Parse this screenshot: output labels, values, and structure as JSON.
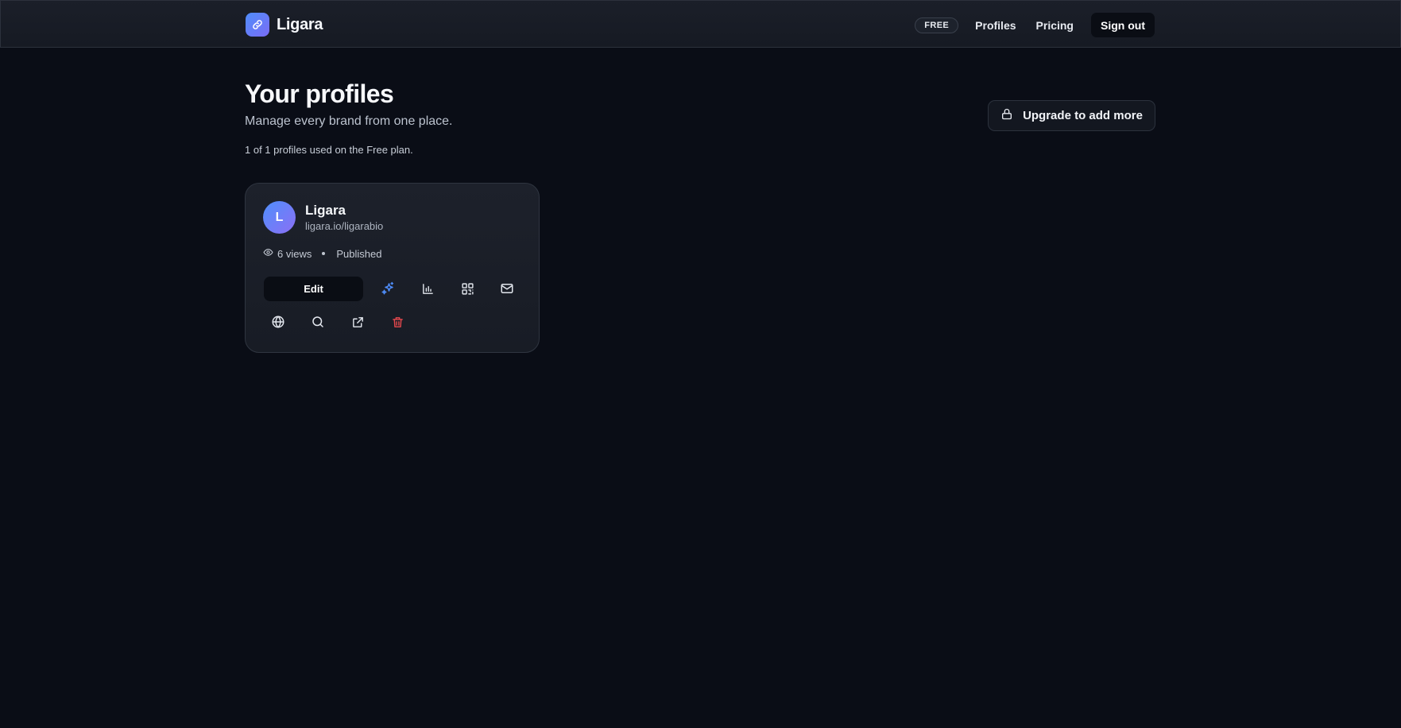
{
  "brand": {
    "name": "Ligara",
    "logo_icon": "link-icon",
    "logo_gradient": [
      "#4f8dfa",
      "#7a6cf6"
    ]
  },
  "nav": {
    "plan_badge": "FREE",
    "profiles": "Profiles",
    "pricing": "Pricing",
    "sign_out": "Sign out"
  },
  "page": {
    "title": "Your profiles",
    "subtitle": "Manage every brand from one place.",
    "usage": "1 of 1 profiles used on the Free plan.",
    "upgrade_label": "Upgrade to add more",
    "upgrade_icon": "lock-icon"
  },
  "profiles": [
    {
      "avatar_initial": "L",
      "name": "Ligara",
      "url": "ligara.io/ligarabio",
      "views": "6 views",
      "status": "Published",
      "edit_label": "Edit",
      "actions_row1": [
        "sparkles-icon",
        "bar-chart-icon",
        "qr-code-icon",
        "mail-icon"
      ],
      "actions_row2": [
        "globe-icon",
        "search-icon",
        "external-link-icon",
        "trash-icon"
      ]
    }
  ],
  "colors": {
    "background": "#0a0d16",
    "header": "#1b1f29",
    "card": "#1d212b",
    "accent": "#4f8dfa",
    "danger": "#e5484d"
  }
}
